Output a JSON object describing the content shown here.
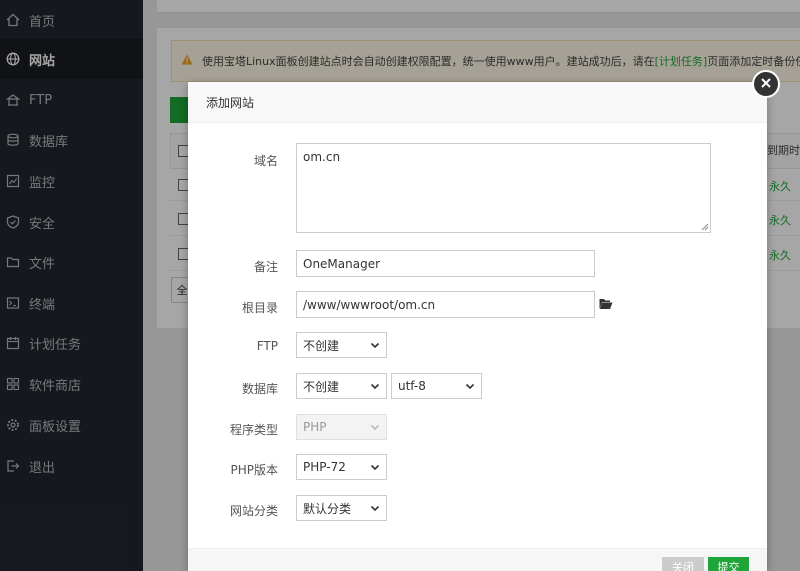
{
  "sidebar": {
    "items": [
      {
        "label": "首页",
        "icon": "home-icon"
      },
      {
        "label": "网站",
        "icon": "globe-icon",
        "active": true
      },
      {
        "label": "FTP",
        "icon": "ftp-icon"
      },
      {
        "label": "数据库",
        "icon": "database-icon"
      },
      {
        "label": "监控",
        "icon": "monitor-icon"
      },
      {
        "label": "安全",
        "icon": "shield-icon"
      },
      {
        "label": "文件",
        "icon": "folder-icon"
      },
      {
        "label": "终端",
        "icon": "terminal-icon"
      },
      {
        "label": "计划任务",
        "icon": "calendar-icon"
      },
      {
        "label": "软件商店",
        "icon": "apps-icon"
      },
      {
        "label": "面板设置",
        "icon": "gear-icon"
      },
      {
        "label": "退出",
        "icon": "logout-icon"
      }
    ]
  },
  "background": {
    "notice_text": "使用宝塔Linux面板创建站点时会自动创建权限配置，统一使用www用户。建站成功后，请在",
    "notice_link": "[计划任务]",
    "notice_tail": "页面添加定时备份任",
    "expire_header": "到期时",
    "expire_values": [
      "永久",
      "永久",
      "永久"
    ],
    "add_button": "添",
    "select_all": "全"
  },
  "modal": {
    "title": "添加网站",
    "domain_label": "域名",
    "domain_value": "om.cn",
    "remark_label": "备注",
    "remark_value": "OneManager",
    "root_label": "根目录",
    "root_value": "/www/wwwroot/om.cn",
    "ftp_label": "FTP",
    "ftp_value": "不创建",
    "db_label": "数据库",
    "db_value": "不创建",
    "db_charset": "utf-8",
    "type_label": "程序类型",
    "type_value": "PHP",
    "php_label": "PHP版本",
    "php_value": "PHP-72",
    "category_label": "网站分类",
    "category_value": "默认分类",
    "cancel_label": "关闭",
    "submit_label": "提交"
  },
  "colors": {
    "accent": "#20a53a",
    "sidebar_bg": "#23262e"
  }
}
